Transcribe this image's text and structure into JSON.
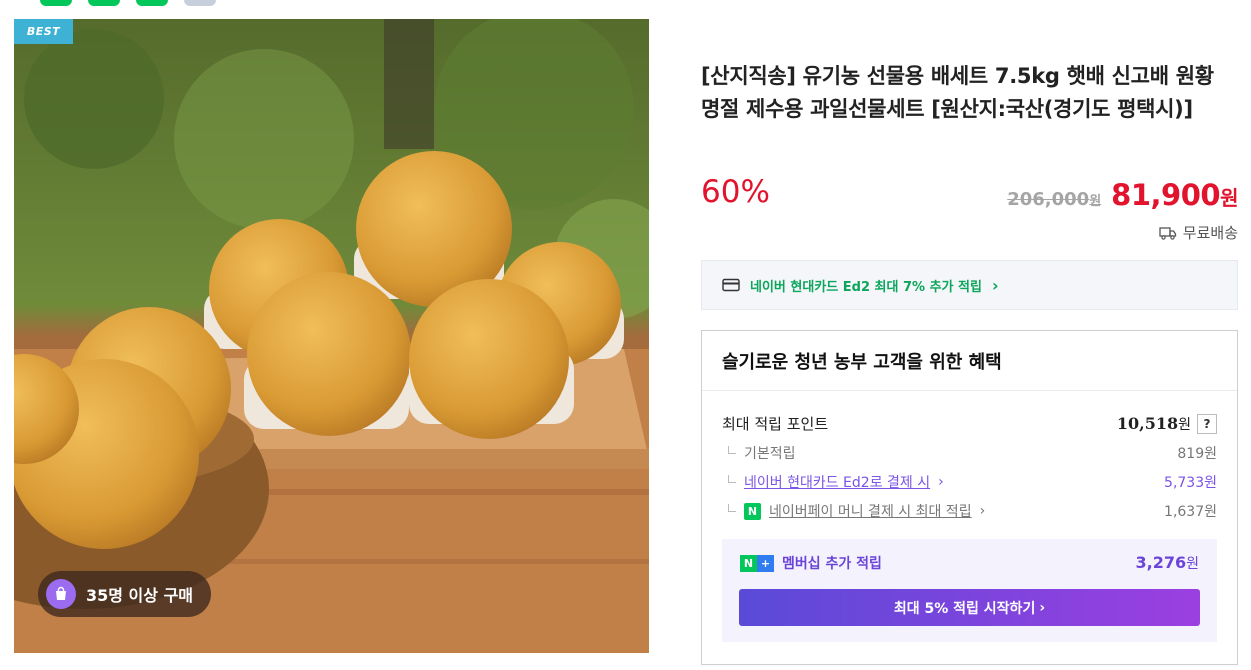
{
  "top_stubs": [
    "#03c75a",
    "#03c75a",
    "#03c75a",
    "#c7cfdc"
  ],
  "image": {
    "badge": "BEST",
    "buyer_count": "35명 이상 구매"
  },
  "product": {
    "title": "[산지직송] 유기농 선물용 배세트 7.5kg 햇배 신고배 원황 명절 제수용 과일선물세트 [원산지:국산(경기도 평택시)]",
    "discount": "60%",
    "original_price": "206,000",
    "original_unit": "원",
    "sale_price": "81,900",
    "sale_unit": "원",
    "shipping": "무료배송"
  },
  "card_benefit": {
    "text": "네이버 현대카드 Ed2 최대 7% 추가 적립",
    "arrow": "›"
  },
  "benefit_box": {
    "heading": "슬기로운 청년 농부 고객을 위한 혜택",
    "max_points_label": "최대 적립 포인트",
    "max_points_value": "10,518",
    "won": "원",
    "help": "?",
    "rows": [
      {
        "label": "기본적립",
        "amount": "819원"
      },
      {
        "label": "네이버 현대카드 Ed2로 결제 시",
        "amount": "5,733원"
      },
      {
        "label": "네이버페이 머니 결제 시 최대 적립",
        "amount": "1,637원"
      }
    ],
    "membership": {
      "label": "멤버십 추가 적립",
      "amount": "3,276",
      "won": "원",
      "button": "최대 5% 적립 시작하기"
    }
  }
}
